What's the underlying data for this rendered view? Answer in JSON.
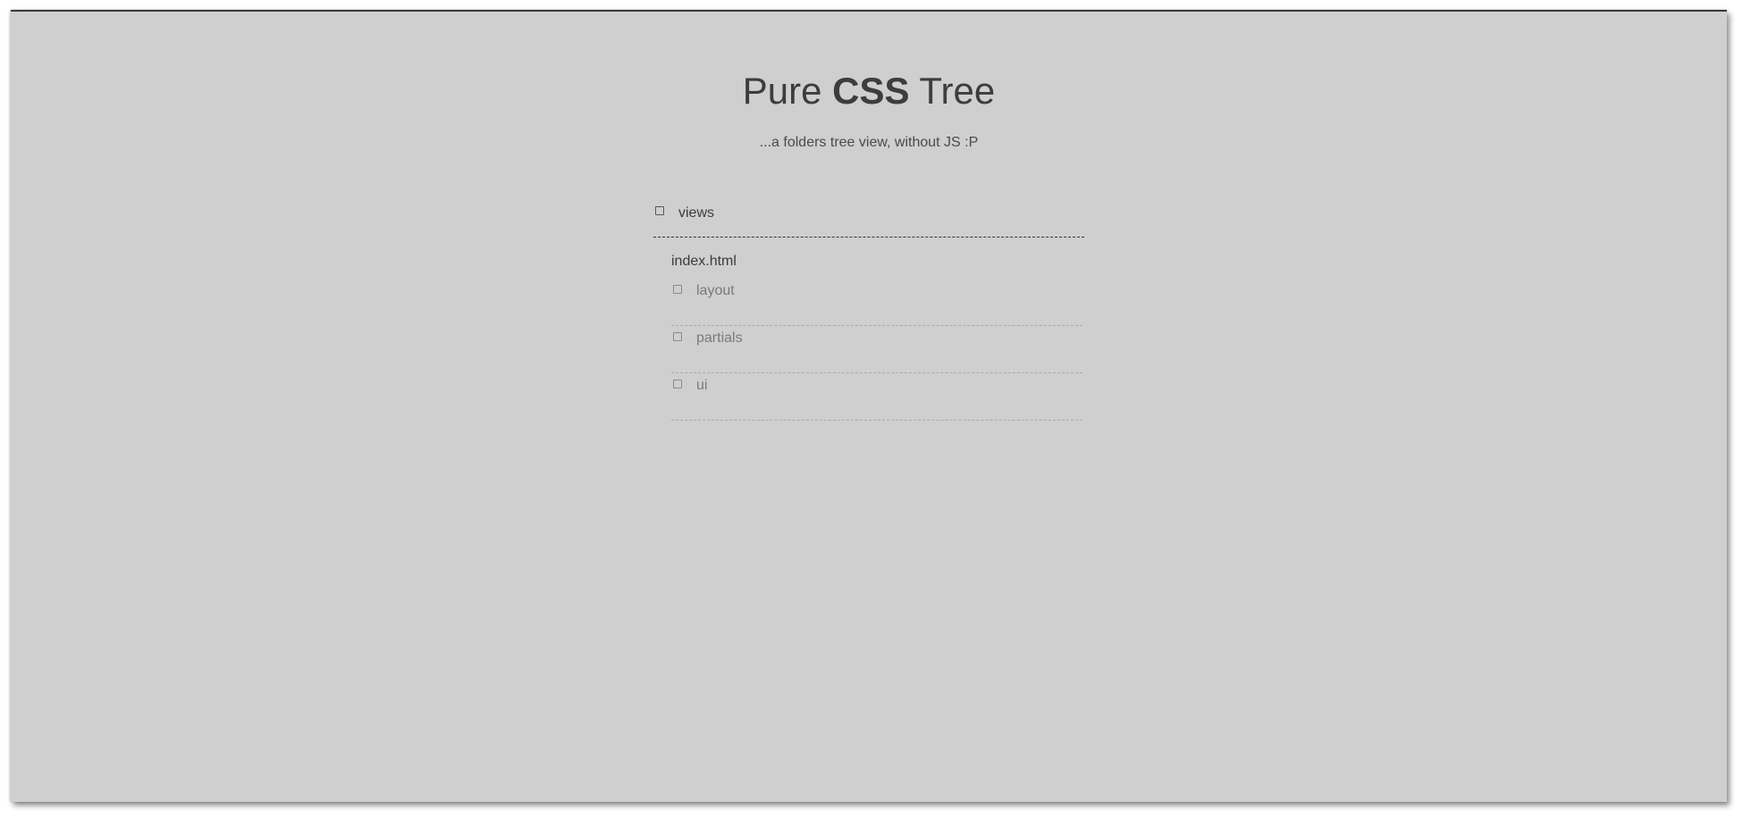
{
  "header": {
    "title_prefix": "Pure",
    "title_bold": "CSS",
    "title_suffix": "Tree",
    "subtitle": "...a folders tree view, without JS :P"
  },
  "tree": {
    "root": {
      "label": "views",
      "icon": "folder-icon",
      "files": [
        "index.html"
      ],
      "folders": [
        {
          "label": "layout",
          "icon": "folder-icon"
        },
        {
          "label": "partials",
          "icon": "folder-icon"
        },
        {
          "label": "ui",
          "icon": "folder-icon"
        }
      ]
    }
  }
}
